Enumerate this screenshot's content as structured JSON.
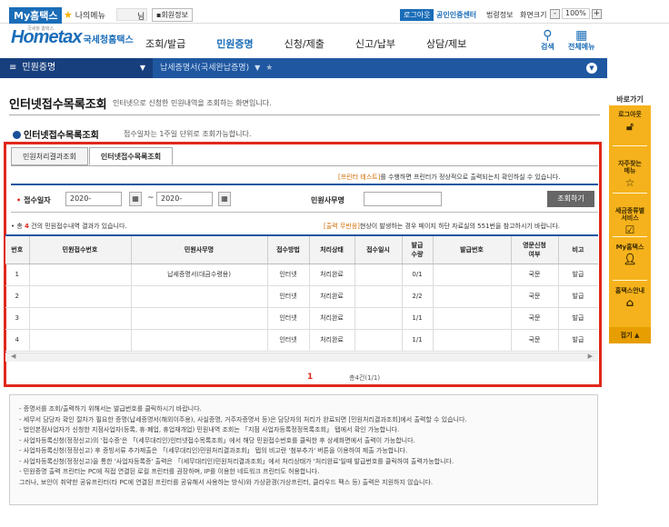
{
  "topbar": {
    "mytax": "My홈택스",
    "mymenu": "나의메뉴",
    "name_suffix": "님",
    "member_info": "회원정보",
    "logout": "로그아웃",
    "cert_center": "공인인증센터",
    "law": "법령정보",
    "zoom_label": "화면크기",
    "zoom_minus": "-",
    "zoom_value": "100%",
    "zoom_plus": "+"
  },
  "header": {
    "logo_small": "국세청 홈택스",
    "logo_big": "Hometax",
    "logo_sub": "국세청홈택스",
    "nav": [
      "조회/발급",
      "민원증명",
      "신청/제출",
      "신고/납부",
      "상담/제보"
    ],
    "active_nav": "민원증명",
    "search_label": "검색",
    "allmenu_label": "전체메뉴"
  },
  "locbar": {
    "menu": "민원증명",
    "current": "납세증명서(국세완납증명)"
  },
  "page": {
    "title": "인터넷접수목록조회",
    "desc": "인터넷으로 신청한 민원내역을 조회하는 화면입니다.",
    "section_title": "인터넷접수목록조회",
    "section_desc": "접수일자는 1주일 단위로 조회가능합니다."
  },
  "tabs": [
    "민원처리결과조회",
    "인터넷접수목록조회"
  ],
  "active_tab": "인터넷접수목록조회",
  "notes_top": {
    "printer_hl": "[프린터 테스트]",
    "printer_rest": "를 수행하면 프린터가 정상적으로 출력되는지 확인하실 수 있습니다."
  },
  "search": {
    "date_label": "접수일자",
    "required_mark": "•",
    "date_from": "2020-",
    "date_to": "2020-",
    "tilde": "~",
    "doc_label": "민원사무명",
    "doc_value": "",
    "button": "조회하기"
  },
  "results": {
    "total_prefix": "• 총 ",
    "total_count": "4",
    "total_suffix": " 건의 민원접수내역 결과가 있습니다.",
    "output_hl": "[출력 무반응]",
    "output_rest": "현상이 발생하는 경우 페이지 하단 자료실의 551번을 참고하시기 바랍니다."
  },
  "table": {
    "headers": [
      "번호",
      "민원접수번호",
      "민원사무명",
      "접수방법",
      "처리상태",
      "접수일시",
      "발급\n수량",
      "발급번호",
      "영문신청\n여부",
      "비고"
    ],
    "rows": [
      [
        "1",
        "",
        "납세증명서(대금수령용)",
        "인터넷",
        "처리완료",
        "",
        "0/1",
        "",
        "국문",
        "발급"
      ],
      [
        "2",
        "",
        "",
        "인터넷",
        "처리완료",
        "",
        "2/2",
        "",
        "국문",
        "발급"
      ],
      [
        "3",
        "",
        "",
        "인터넷",
        "처리완료",
        "",
        "1/1",
        "",
        "국문",
        "발급"
      ],
      [
        "4",
        "",
        "",
        "인터넷",
        "처리완료",
        "",
        "1/1",
        "",
        "국문",
        "발급"
      ]
    ]
  },
  "pager": {
    "current": "1",
    "total": "총4건(1/1)"
  },
  "notes": [
    "- 증명서를 조회/출력하기 위해서는 발급번호를 클릭하시기 바랍니다.",
    "- 세무서 담당자 확인 절차가 필요한 증명(납세증명서(해외이주용), 사실증명, 거주자증명서 등)은 담당자의 처리가 완료되면 [민원처리결과조회]에서 출력할 수 있습니다.",
    "- 법인본점사업자가 신청한 지점사업자(등록, 휴·폐업, 휴업재개업) 민원내역 조회는 「지점 사업자등록정정목록조회」 탭에서 확인 가능합니다.",
    "- 사업자등록신청(정정신고)의 '접수증'은 「(세무대리인)인터넷접수목록조회」에서 해당 민원접수번호를 클릭한 후 상세화면에서 출력이 가능합니다.",
    "- 사업자등록신청(정정신고) 후 증빙서류 추가제출은 「(세무대리인)민원처리결과조회」 탭의 비고란 '첨부추가' 버튼을 이용하여 제출 가능합니다.",
    "- 사업자등록신청(정정신고)을 통한 '사업자등록증' 출력은 「(세무대리인)민원처리결과조회」에서 처리상태가 '처리완료'일때 발급번호를 클릭하여 출력가능합니다.",
    "- 민원증명 출력 프린터는 PC에 직접 연결된 로컬 프린터를 권장하며, IP를 이용한 네트워크 프린터도 허용합니다.",
    "  그러나, 보안이 취약한 공유프린터(타 PC에 연결된 프린터를 공유해서 사용하는 방식)와 가상환경(가상프린터, 클라우드 팩스 등) 출력은 지원하지 않습니다."
  ],
  "quickbar": {
    "title": "바로가기",
    "items": [
      "로그아웃",
      "자주찾는\n메뉴",
      "세금종류별\n서비스",
      "My홈택스",
      "홈택스안내"
    ],
    "close": "접기"
  }
}
